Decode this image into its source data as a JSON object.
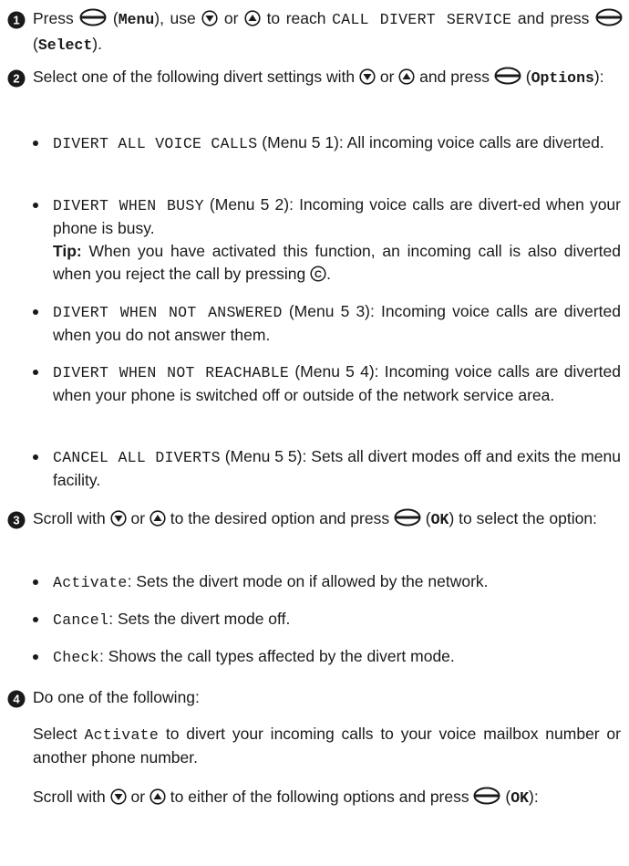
{
  "steps": [
    {
      "number": "1",
      "text": [
        {
          "t": "Press "
        },
        {
          "icon": "selection-key-icon"
        },
        {
          "t": " ("
        },
        {
          "mb": "Menu"
        },
        {
          "t": "), use "
        },
        {
          "icon": "scroll-down-key-icon"
        },
        {
          "t": " or "
        },
        {
          "icon": "scroll-up-key-icon"
        },
        {
          "t": " to reach "
        },
        {
          "m": "CALL DIVERT SERVICE"
        },
        {
          "t": " and press "
        },
        {
          "icon": "selection-key-icon"
        },
        {
          "t": " ("
        },
        {
          "mb": "Select"
        },
        {
          "t": ")."
        }
      ]
    },
    {
      "number": "2",
      "text": [
        {
          "t": "Select one of the following divert settings with "
        },
        {
          "icon": "scroll-down-key-icon"
        },
        {
          "t": " or "
        },
        {
          "icon": "scroll-up-key-icon"
        },
        {
          "t": " and press "
        },
        {
          "icon": "selection-key-icon"
        },
        {
          "t": " ("
        },
        {
          "mb": "Options"
        },
        {
          "t": "):"
        }
      ],
      "bullets": [
        [
          {
            "m": "DIVERT ALL VOICE CALLS"
          },
          {
            "t": " (Menu 5 1): All incoming voice calls are diverted."
          }
        ],
        [
          {
            "m": "DIVERT WHEN BUSY"
          },
          {
            "t": " (Menu 5 2): Incoming voice calls are divert-ed when your phone is busy."
          },
          {
            "br": true
          },
          {
            "b": "Tip:"
          },
          {
            "t": " When you have activated this function, an incoming call is also diverted when you reject the call by pressing "
          },
          {
            "icon": "clear-key-icon"
          },
          {
            "t": "."
          }
        ],
        [
          {
            "m": "DIVERT WHEN NOT ANSWERED"
          },
          {
            "t": " (Menu 5 3): Incoming voice calls are diverted when you do not answer them."
          }
        ],
        [
          {
            "m": "DIVERT WHEN NOT REACHABLE"
          },
          {
            "t": " (Menu 5 4): Incoming voice calls are diverted when your phone is switched off or outside of the network service area."
          }
        ],
        [
          {
            "m": "CANCEL ALL DIVERTS"
          },
          {
            "t": " (Menu 5 5): Sets all divert modes off and exits the menu facility."
          }
        ]
      ]
    },
    {
      "number": "3",
      "text": [
        {
          "t": "Scroll with "
        },
        {
          "icon": "scroll-down-key-icon"
        },
        {
          "t": " or "
        },
        {
          "icon": "scroll-up-key-icon"
        },
        {
          "t": " to the desired option and press "
        },
        {
          "icon": "selection-key-icon"
        },
        {
          "t": " ("
        },
        {
          "mb": "OK"
        },
        {
          "t": ") to select the option:"
        }
      ],
      "bullets": [
        [
          {
            "m": "Activate"
          },
          {
            "t": ": Sets the divert mode on if allowed by the network."
          }
        ],
        [
          {
            "m": "Cancel"
          },
          {
            "t": ": Sets the divert mode off."
          }
        ],
        [
          {
            "m": "Check"
          },
          {
            "t": ": Shows the call types affected by the divert mode."
          }
        ]
      ]
    },
    {
      "number": "4",
      "text": [
        {
          "t": "Do one of the following:"
        }
      ],
      "paragraphs": [
        [
          {
            "t": "Select "
          },
          {
            "m": "Activate"
          },
          {
            "t": " to divert your incoming calls to your voice mailbox number or another phone number."
          }
        ],
        [
          {
            "t": "Scroll with "
          },
          {
            "icon": "scroll-down-key-icon"
          },
          {
            "t": " or "
          },
          {
            "icon": "scroll-up-key-icon"
          },
          {
            "t": " to either of the following options and press "
          },
          {
            "icon": "selection-key-icon"
          },
          {
            "t": " ("
          },
          {
            "mb": "OK"
          },
          {
            "t": "):"
          }
        ]
      ]
    }
  ]
}
